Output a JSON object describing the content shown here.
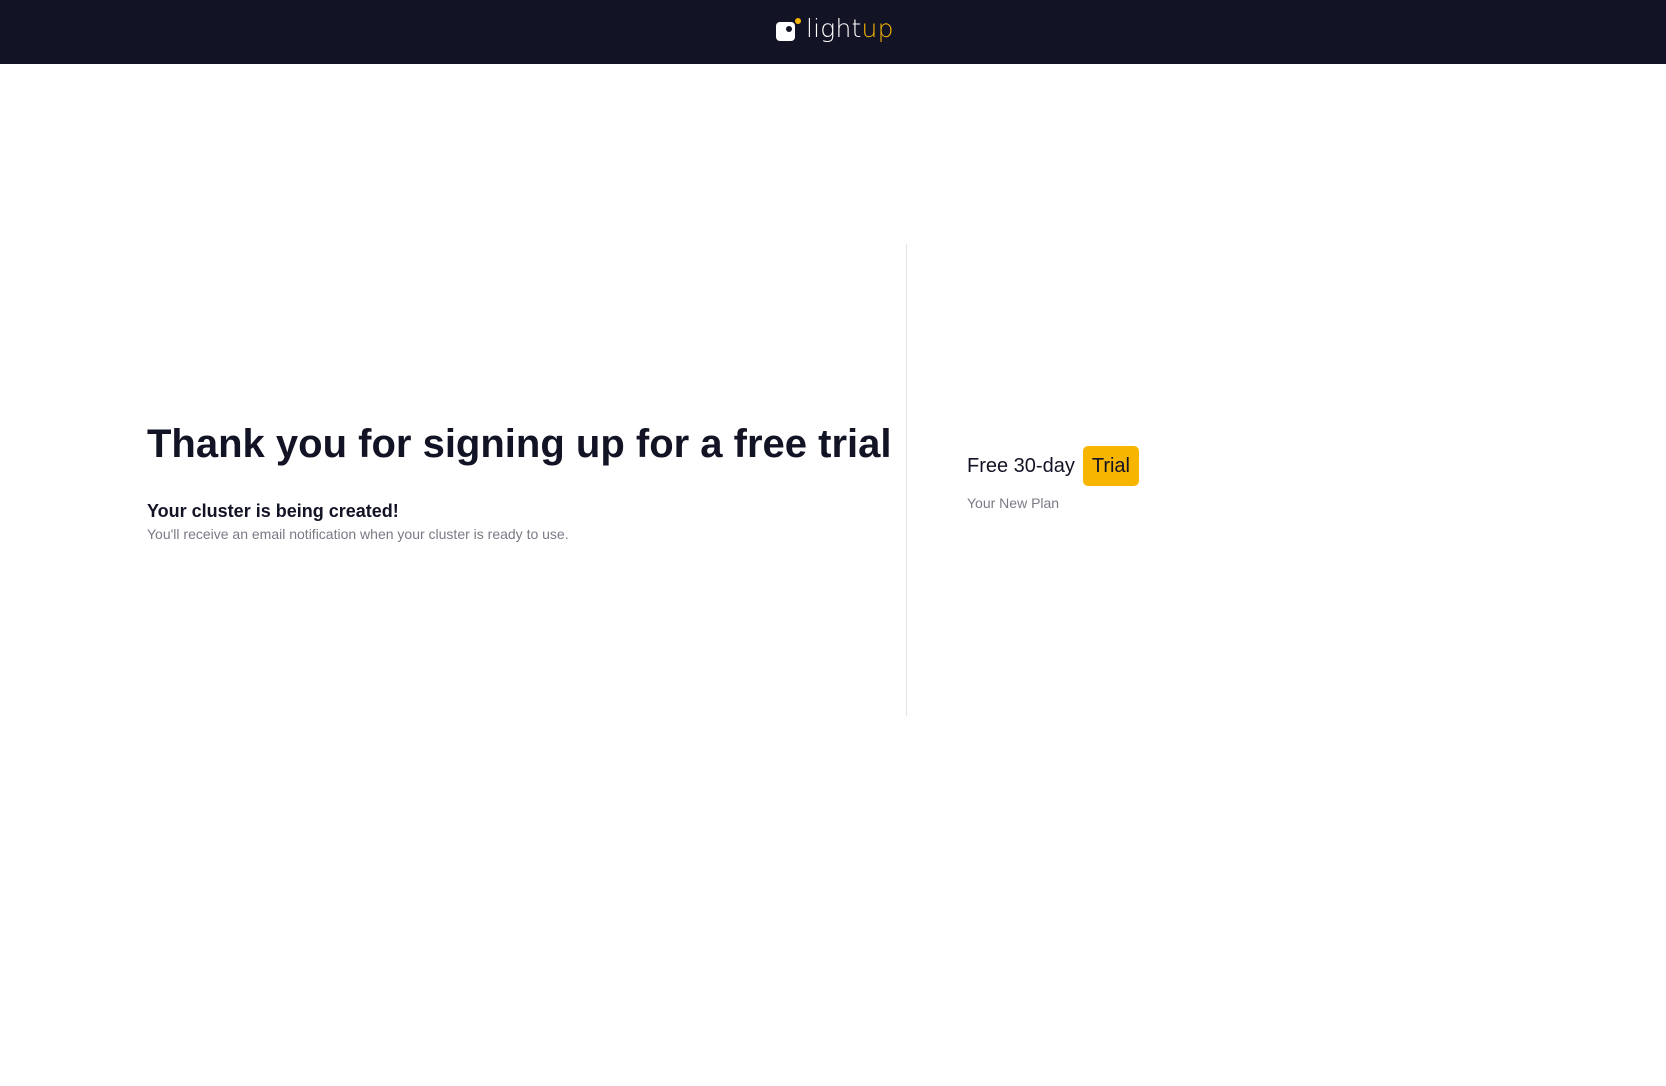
{
  "header": {
    "logo_text_primary": "light",
    "logo_text_accent": "up",
    "background_color": "#131326",
    "accent_color": "#f7b500"
  },
  "main": {
    "headline": "Thank you for signing up for a free trial",
    "status_title": "Your cluster is being created!",
    "status_message": "You'll receive an email notification when your cluster is ready to use."
  },
  "plan": {
    "name": "Free 30-day",
    "badge": "Trial",
    "caption": "Your New Plan",
    "badge_color": "#f7b500"
  }
}
